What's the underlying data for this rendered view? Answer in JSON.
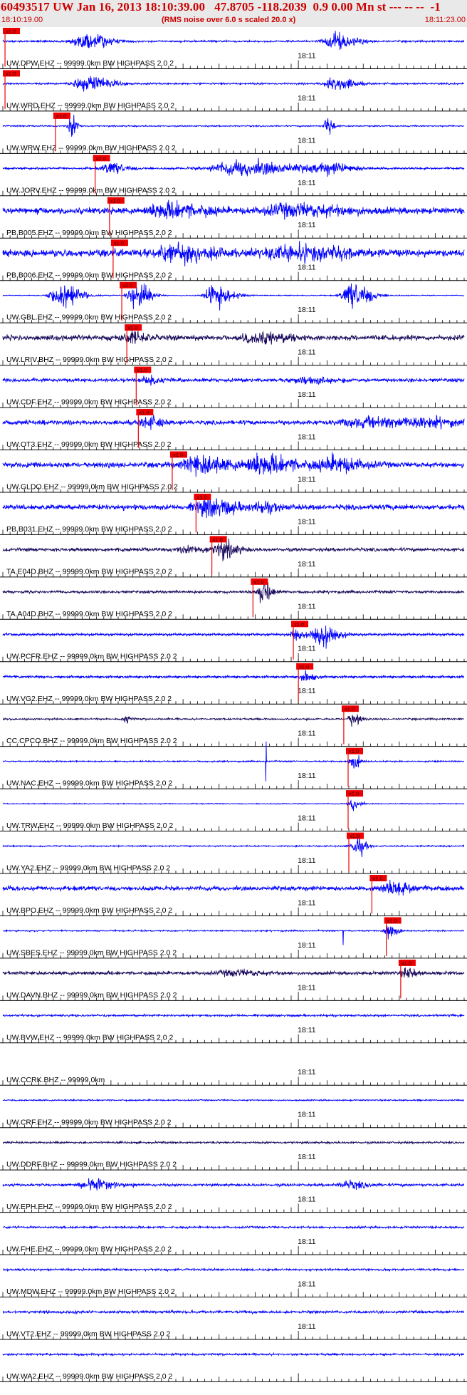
{
  "header": {
    "title": "60493517 UW Jan 16, 2013 18:10:39.00   47.8705 -118.2039  0.9 0.00 Mn st --- -- --  -1",
    "start_time": "18:10:19.00",
    "subtitle": "(RMS noise over 6.0 s scaled 20.0 x)",
    "end_time": "18:11:23.00"
  },
  "colors": {
    "trace_blue": "#0000ff",
    "trace_navy": "#1a0a5c",
    "pick_red": "#ee0000",
    "axis_black": "#000000",
    "header_red": "#cc0000"
  },
  "chart_data": {
    "type": "seismogram",
    "x_range_seconds": [
      0,
      64
    ],
    "minute_tick_label": "18:11",
    "minute_tick_second": 41,
    "pick_label": "x1.0",
    "channels": [
      {
        "label": "UW.DPW.EHZ -- 99999.0km BW  HIGHPASS  2.0  2",
        "color": "navy_blue",
        "pick_s": 0.3,
        "features": [
          [
            11.5,
            2.5,
            1.0
          ],
          [
            46.0,
            2.2,
            0.9
          ]
        ],
        "noise": 0.1,
        "trend": 0,
        "spikes": [],
        "clip": false,
        "tick_label": true
      },
      {
        "label": "UW.WRD.EHZ -- 99999.0km BW  HIGHPASS  2.0  2",
        "color": "blue",
        "pick_s": 0.3,
        "features": [
          [
            11.6,
            2.5,
            1.0
          ],
          [
            46.0,
            2.0,
            0.8
          ]
        ],
        "noise": 0.1,
        "trend": 0,
        "spikes": [],
        "clip": false,
        "tick_label": true
      },
      {
        "label": "UW.WRW.EHZ -- 99999.0km BW  HIGHPASS  2.0  2",
        "color": "blue",
        "pick_s": 7.3,
        "features": [
          [
            9.5,
            0.6,
            1.3
          ],
          [
            45.0,
            0.6,
            1.3
          ]
        ],
        "noise": 0.08,
        "trend": 0,
        "spikes": [],
        "clip": true,
        "tick_label": true
      },
      {
        "label": "UW.JORV.EHZ -- 99999.0km BW  HIGHPASS  2.0  2",
        "color": "blue",
        "pick_s": 12.8,
        "features": [
          [
            15.0,
            1.8,
            0.6
          ],
          [
            33.0,
            6.0,
            0.8
          ],
          [
            45.0,
            3.0,
            0.5
          ]
        ],
        "noise": 0.12,
        "trend": 0,
        "spikes": [],
        "clip": false,
        "tick_label": true
      },
      {
        "label": "PB.B005.EHZ -- 99999.0km BW  HIGHPASS  2.0  2",
        "color": "blue",
        "pick_s": 14.8,
        "features": [
          [
            23.0,
            4.0,
            0.7
          ],
          [
            40.0,
            6.0,
            0.6
          ]
        ],
        "noise": 0.35,
        "trend": 0,
        "spikes": [],
        "clip": false,
        "tick_label": true
      },
      {
        "label": "PB.B006.EHZ -- 99999.0km BW  HIGHPASS  2.0  2",
        "color": "blue",
        "pick_s": 15.3,
        "features": [
          [
            24.0,
            4.0,
            0.8
          ],
          [
            40.0,
            6.0,
            0.7
          ]
        ],
        "noise": 0.4,
        "trend": 0,
        "spikes": [],
        "clip": false,
        "tick_label": true
      },
      {
        "label": "UW.GBL.EHZ -- 99999.0km BW  HIGHPASS  2.0  2",
        "color": "blue",
        "pick_s": 16.5,
        "features": [
          [
            8.0,
            2.0,
            1.5
          ],
          [
            18.5,
            1.5,
            1.5
          ],
          [
            29.5,
            1.8,
            1.5
          ],
          [
            48.5,
            2.0,
            1.5
          ]
        ],
        "noise": 0.05,
        "trend": 0,
        "spikes": [],
        "clip": true,
        "tick_label": true
      },
      {
        "label": "UW.LRIV.BHZ -- 99999.0km BW  HIGHPASS  2.0  2",
        "color": "navy",
        "pick_s": 17.2,
        "features": [
          [
            18.0,
            1.5,
            0.6
          ],
          [
            35.0,
            3.0,
            0.5
          ]
        ],
        "noise": 0.3,
        "trend": 0,
        "spikes": [],
        "clip": false,
        "tick_label": true
      },
      {
        "label": "UW.CDF.EHZ -- 99999.0km BW  HIGHPASS  2.0  2",
        "color": "blue",
        "pick_s": 18.5,
        "features": [
          [
            20.0,
            1.5,
            0.5
          ],
          [
            42.0,
            3.0,
            0.3
          ]
        ],
        "noise": 0.2,
        "trend": 0,
        "spikes": [],
        "clip": false,
        "tick_label": true
      },
      {
        "label": "UW.OT3.EHZ -- 99999.0km BW  HIGHPASS  2.0  2",
        "color": "blue",
        "pick_s": 18.8,
        "features": [
          [
            20.0,
            1.5,
            0.6
          ],
          [
            50.0,
            5.0,
            0.5
          ],
          [
            58.0,
            4.0,
            0.4
          ]
        ],
        "noise": 0.25,
        "trend": 0,
        "spikes": [],
        "clip": false,
        "tick_label": true
      },
      {
        "label": "UW.GLDO.EHZ -- 99999.0km BW  HIGHPASS  2.0  2",
        "color": "blue",
        "pick_s": 23.5,
        "features": [
          [
            27.0,
            3.0,
            1.0
          ],
          [
            36.0,
            4.0,
            0.9
          ],
          [
            46.0,
            3.0,
            0.8
          ]
        ],
        "noise": 0.3,
        "trend": 0,
        "spikes": [],
        "clip": false,
        "tick_label": true
      },
      {
        "label": "PB.B031.EHZ -- 99999.0km BW  HIGHPASS  2.0  2",
        "color": "blue",
        "pick_s": 26.8,
        "features": [
          [
            28.5,
            3.0,
            0.9
          ],
          [
            36.0,
            2.0,
            0.4
          ]
        ],
        "noise": 0.3,
        "trend": 0,
        "spikes": [],
        "clip": false,
        "tick_label": true
      },
      {
        "label": "TA.E04D.BHZ -- 99999.0km BW  HIGHPASS  2.0  2",
        "color": "navy",
        "pick_s": 29.0,
        "features": [
          [
            30.5,
            1.5,
            0.9
          ],
          [
            26.0,
            3.0,
            0.3
          ]
        ],
        "noise": 0.2,
        "trend": 0,
        "spikes": [],
        "clip": false,
        "tick_label": true
      },
      {
        "label": "TA.A04D.BHZ -- 99999.0km BW  HIGHPASS  2.0  2",
        "color": "navy",
        "pick_s": 34.7,
        "features": [
          [
            36.0,
            1.0,
            1.3
          ]
        ],
        "noise": 0.15,
        "trend": 0,
        "spikes": [],
        "clip": false,
        "tick_label": true
      },
      {
        "label": "UW.PCFR.EHZ -- 99999.0km BW  HIGHPASS  2.0  2",
        "color": "blue",
        "pick_s": 40.3,
        "features": [
          [
            44.0,
            1.8,
            1.2
          ],
          [
            40.5,
            0.8,
            0.7
          ]
        ],
        "noise": 0.15,
        "trend": 0,
        "spikes": [],
        "clip": false,
        "tick_label": true
      },
      {
        "label": "UW.VG2.EHZ -- 99999.0km BW  HIGHPASS  2.0  2",
        "color": "blue",
        "pick_s": 41.0,
        "features": [
          [
            42.0,
            1.0,
            0.5
          ]
        ],
        "noise": 0.15,
        "trend": 0,
        "spikes": [],
        "clip": false,
        "tick_label": true
      },
      {
        "label": "CC.CPCO.BHZ -- 99999.0km BW  HIGHPASS  2.0  2",
        "color": "navy",
        "pick_s": 47.3,
        "features": [
          [
            48.5,
            0.8,
            0.8
          ],
          [
            17.0,
            0.6,
            0.4
          ]
        ],
        "noise": 0.1,
        "trend": 0,
        "spikes": [],
        "clip": false,
        "tick_label": true
      },
      {
        "label": "UW.NAC.EHZ -- 99999.0km BW  HIGHPASS  2.0  2",
        "color": "blue",
        "pick_s": 47.9,
        "features": [
          [
            48.5,
            0.8,
            0.9
          ]
        ],
        "noise": 0.08,
        "trend": 0,
        "spikes": [
          [
            36.5,
            1.4
          ]
        ],
        "clip": false,
        "tick_label": true
      },
      {
        "label": "UW.TRW.EHZ -- 99999.0km BW  HIGHPASS  2.0  2",
        "color": "blue",
        "pick_s": 47.9,
        "features": [
          [
            48.5,
            0.8,
            0.8
          ]
        ],
        "noise": 0.05,
        "trend": 0,
        "spikes": [],
        "clip": false,
        "tick_label": true
      },
      {
        "label": "UW.YA2.EHZ -- 99999.0km BW  HIGHPASS  2.0  2",
        "color": "blue",
        "pick_s": 48.0,
        "features": [
          [
            49.0,
            0.9,
            1.3
          ]
        ],
        "noise": 0.08,
        "trend": 0,
        "spikes": [],
        "clip": false,
        "tick_label": true
      },
      {
        "label": "UW.BPO.EHZ -- 99999.0km BW  HIGHPASS  2.0  2",
        "color": "blue",
        "pick_s": 51.2,
        "features": [
          [
            54.0,
            2.5,
            0.6
          ]
        ],
        "noise": 0.25,
        "trend": 0,
        "spikes": [],
        "clip": false,
        "tick_label": true
      },
      {
        "label": "UW.SBES.EHZ -- 99999.0km BW  HIGHPASS  2.0  2",
        "color": "blue",
        "pick_s": 53.2,
        "features": [
          [
            53.5,
            0.8,
            1.2
          ]
        ],
        "noise": 0.08,
        "trend": 0,
        "spikes": [
          [
            47.2,
            1.0
          ]
        ],
        "clip": false,
        "tick_label": true
      },
      {
        "label": "UW.DAVN.BHZ -- 99999.0km BW  HIGHPASS  2.0  2",
        "color": "navy",
        "pick_s": 55.2,
        "features": [
          [
            56.0,
            1.0,
            0.6
          ],
          [
            32.0,
            3.0,
            0.3
          ]
        ],
        "noise": 0.2,
        "trend": 0,
        "spikes": [],
        "clip": false,
        "tick_label": true
      },
      {
        "label": "UW.BVW.EHZ -- 99999.0km BW  HIGHPASS  2.0  2",
        "color": "blue",
        "pick_s": null,
        "features": [],
        "noise": 0.12,
        "trend": 0,
        "spikes": [],
        "clip": false,
        "tick_label": true
      },
      {
        "label": "UW.CCRK.BHZ -- 99999.0km",
        "color": "none",
        "pick_s": null,
        "features": [],
        "noise": 0,
        "trend": 0,
        "spikes": [],
        "clip": false,
        "tick_label": true
      },
      {
        "label": "UW.CRF.EHZ -- 99999.0km BW  HIGHPASS  2.0  2",
        "color": "blue",
        "pick_s": null,
        "features": [],
        "noise": 0.08,
        "trend": 0,
        "spikes": [],
        "clip": false,
        "tick_label": true
      },
      {
        "label": "UW.DDRF.BHZ -- 99999.0km BW  HIGHPASS  2.0  2",
        "color": "navy",
        "pick_s": null,
        "features": [],
        "noise": 0.12,
        "trend": 0,
        "spikes": [],
        "clip": false,
        "tick_label": true
      },
      {
        "label": "UW.EPH.EHZ -- 99999.0km BW  HIGHPASS  2.0  2",
        "color": "blue",
        "pick_s": null,
        "features": [
          [
            12.5,
            2.5,
            0.6
          ],
          [
            48.0,
            2.0,
            0.4
          ]
        ],
        "noise": 0.15,
        "trend": 0,
        "spikes": [],
        "clip": false,
        "tick_label": true
      },
      {
        "label": "UW.FHE.EHZ -- 99999.0km BW  HIGHPASS  2.0  2",
        "color": "blue",
        "pick_s": null,
        "features": [],
        "noise": 0.12,
        "trend": 0,
        "spikes": [],
        "clip": false,
        "tick_label": true
      },
      {
        "label": "UW.MDW.EHZ -- 99999.0km BW  HIGHPASS  2.0  2",
        "color": "blue",
        "pick_s": null,
        "features": [],
        "noise": 0.12,
        "trend": 0,
        "spikes": [],
        "clip": false,
        "tick_label": true
      },
      {
        "label": "UW.VT2.EHZ -- 99999.0km BW  HIGHPASS  2.0  2",
        "color": "blue",
        "pick_s": null,
        "features": [],
        "noise": 0.15,
        "trend": 0,
        "spikes": [],
        "clip": false,
        "tick_label": true
      },
      {
        "label": "UW.WA2.EHZ -- 99999.0km BW  HIGHPASS  2.0  2",
        "color": "blue",
        "pick_s": null,
        "features": [],
        "noise": 0.12,
        "trend": 0,
        "spikes": [],
        "clip": false,
        "tick_label": false
      }
    ]
  }
}
